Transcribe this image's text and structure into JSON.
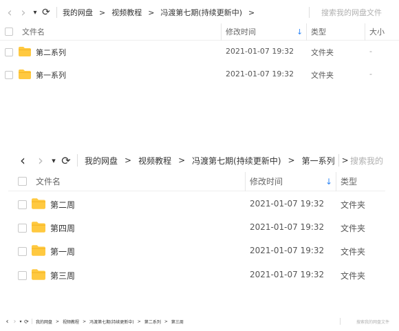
{
  "icons": {
    "back": "‹",
    "forward": "›",
    "dropdown": "▾",
    "refresh": "⟳",
    "sort_down": "↓"
  },
  "colors": {
    "folder": "#FFC940",
    "folder_tab": "#F5B524",
    "accent": "#2F86F6"
  },
  "view1": {
    "breadcrumbs": [
      "我的网盘",
      "视频教程",
      "冯渡第七期(持续更新中)"
    ],
    "trailing_sep": ">",
    "search_placeholder": "搜索我的网盘文件",
    "headers": {
      "name": "文件名",
      "modified": "修改时间",
      "type": "类型",
      "size": "大小"
    },
    "rows": [
      {
        "name": "第二系列",
        "modified": "2021-01-07 19:32",
        "type": "文件夹",
        "size": "-"
      },
      {
        "name": "第一系列",
        "modified": "2021-01-07 19:32",
        "type": "文件夹",
        "size": "-"
      }
    ]
  },
  "view2": {
    "breadcrumbs": [
      "我的网盘",
      "视频教程",
      "冯渡第七期(持续更新中)",
      "第一系列"
    ],
    "trailing_sep": ">",
    "search_placeholder": "搜索我的",
    "headers": {
      "name": "文件名",
      "modified": "修改时间",
      "type": "类型"
    },
    "rows": [
      {
        "name": "第二周",
        "modified": "2021-01-07 19:32",
        "type": "文件夹"
      },
      {
        "name": "第四周",
        "modified": "2021-01-07 19:32",
        "type": "文件夹"
      },
      {
        "name": "第一周",
        "modified": "2021-01-07 19:32",
        "type": "文件夹"
      },
      {
        "name": "第三周",
        "modified": "2021-01-07 19:32",
        "type": "文件夹"
      }
    ]
  },
  "view3": {
    "breadcrumbs": [
      "我的网盘",
      "视频教程",
      "冯渡第七期(持续更新中)",
      "第二系列",
      "第三周"
    ],
    "search_placeholder": "搜索我的网盘文件"
  }
}
